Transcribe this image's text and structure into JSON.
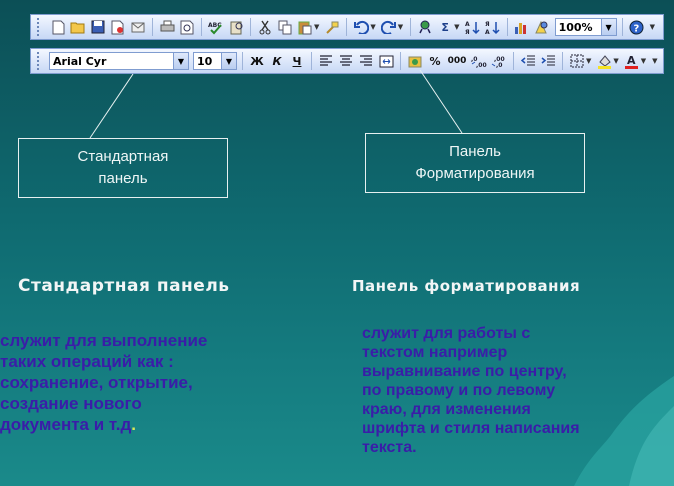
{
  "standard_toolbar": {
    "icons": [
      "new-icon",
      "open-icon",
      "save-icon",
      "permission-icon",
      "email-icon",
      "print-icon",
      "print-preview-icon",
      "spelling-icon",
      "research-icon",
      "cut-icon",
      "copy-icon",
      "paste-icon",
      "format-painter-icon",
      "undo-icon",
      "redo-icon",
      "hyperlink-icon",
      "autosum-icon",
      "sort-ascending-icon",
      "sort-descending-icon",
      "chart-wizard-icon",
      "drawing-icon",
      "help-icon"
    ],
    "zoom": "100%"
  },
  "formatting_toolbar": {
    "font_name": "Arial Cyr",
    "font_size": "10",
    "bold": "Ж",
    "italic": "К",
    "underline": "Ч",
    "percent": "%",
    "thousands": "000"
  },
  "callouts": {
    "standard": "Стандартная\nпанель",
    "formatting": "Панель\nФорматирования"
  },
  "sections": {
    "standard_heading": "Стандартная панель",
    "standard_body": " служит для выполнение\nтаких операций как :\nсохранение, открытие,\nсоздание нового\nдокумента и т.д",
    "standard_body_end": ".",
    "formatting_heading": "Панель форматирования",
    "formatting_body": "  служит для работы с\nтекстом например\nвыравнивание по центру,\nпо правому и по левому\nкраю, для изменения\nшрифта и стиля написания\nтекста."
  },
  "colors": {
    "background": "#0f6a70",
    "callout_text": "#eef6f6",
    "body_text": "#3a1da8"
  }
}
